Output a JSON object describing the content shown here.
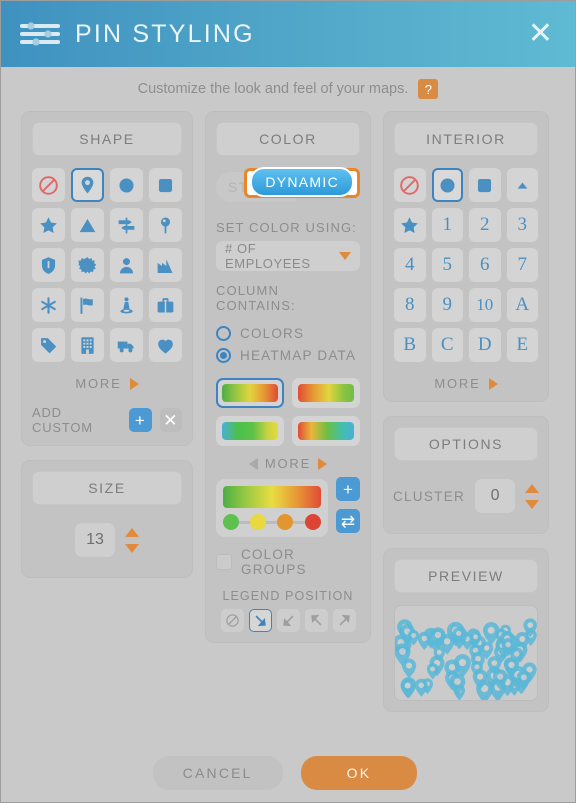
{
  "header": {
    "title": "PIN STYLING",
    "icon": "sliders-icon",
    "close_label": "✕"
  },
  "subtitle": {
    "text": "Customize the look and feel of your maps.",
    "help_label": "?"
  },
  "shape": {
    "header": "SHAPE",
    "icons": [
      {
        "name": "no-shape-icon",
        "glyph": "none",
        "selected": false
      },
      {
        "name": "map-pin-icon",
        "glyph": "pin",
        "selected": true
      },
      {
        "name": "circle-icon",
        "glyph": "circle",
        "selected": false
      },
      {
        "name": "square-icon",
        "glyph": "square",
        "selected": false
      },
      {
        "name": "star-icon",
        "glyph": "star",
        "selected": false
      },
      {
        "name": "triangle-icon",
        "glyph": "triangle",
        "selected": false
      },
      {
        "name": "signpost-icon",
        "glyph": "signpost",
        "selected": false
      },
      {
        "name": "pushpin-icon",
        "glyph": "pushpin",
        "selected": false
      },
      {
        "name": "shield-icon",
        "glyph": "shield",
        "selected": false
      },
      {
        "name": "burst-icon",
        "glyph": "burst",
        "selected": false
      },
      {
        "name": "person-icon",
        "glyph": "person",
        "selected": false
      },
      {
        "name": "factory-icon",
        "glyph": "factory",
        "selected": false
      },
      {
        "name": "asterisk-icon",
        "glyph": "asterisk",
        "selected": false
      },
      {
        "name": "flag-icon",
        "glyph": "flag",
        "selected": false
      },
      {
        "name": "statue-icon",
        "glyph": "statue",
        "selected": false
      },
      {
        "name": "briefcase-icon",
        "glyph": "briefcase",
        "selected": false
      },
      {
        "name": "tag-icon",
        "glyph": "tag",
        "selected": false
      },
      {
        "name": "building-icon",
        "glyph": "building",
        "selected": false
      },
      {
        "name": "truck-icon",
        "glyph": "truck",
        "selected": false
      },
      {
        "name": "heart-icon",
        "glyph": "heart",
        "selected": false
      }
    ],
    "more_label": "MORE",
    "add_custom_label": "ADD CUSTOM",
    "add_label": "+",
    "remove_label": "✕"
  },
  "size": {
    "header": "SIZE",
    "value": "13"
  },
  "color": {
    "header": "COLOR",
    "static_label": "STATIC",
    "dynamic_label": "DYNAMIC",
    "dynamic_selected": true,
    "highlight_color": "#e8862a",
    "set_color_using_label": "SET COLOR USING:",
    "column_value": "# OF EMPLOYEES",
    "column_contains_label": "COLUMN CONTAINS:",
    "options": [
      {
        "label": "COLORS",
        "selected": false
      },
      {
        "label": "HEATMAP DATA",
        "selected": true
      }
    ],
    "gradients": [
      {
        "name": "gradient-green-yellow-red",
        "css": "linear-gradient(90deg,#4caf45 0%,#8fc442 22%,#e2d53e 50%,#e79a36 74%,#e04b35 100%)",
        "selected": true
      },
      {
        "name": "gradient-red-yellow-green",
        "css": "linear-gradient(90deg,#e04b35 0%,#e79a36 28%,#e2d53e 55%,#8fc442 80%,#6dbf44 100%)",
        "selected": false
      },
      {
        "name": "gradient-blue-green-yellow",
        "css": "linear-gradient(90deg,#49b0d8 0%,#4cc04c 28%,#5cc148 55%,#c9d341 82%,#e6d93d 100%)",
        "selected": false
      },
      {
        "name": "gradient-red-green-blue",
        "css": "linear-gradient(90deg,#e04b35 0%,#e8b63a 24%,#6dbf44 52%,#43bfa8 78%,#49b0d8 100%)",
        "selected": false
      }
    ],
    "gradient_more_label": "MORE",
    "editor_bar_css": "linear-gradient(90deg,#4caf45 0%,#9cc943 24%,#e8dd42 50%,#e79a36 75%,#e04b35 100%)",
    "stops": [
      {
        "name": "color-stop-green",
        "color": "#5ec04e",
        "pos": 0
      },
      {
        "name": "color-stop-yellow",
        "color": "#e8d940",
        "pos": 33
      },
      {
        "name": "color-stop-orange",
        "color": "#e2962f",
        "pos": 66
      },
      {
        "name": "color-stop-red",
        "color": "#dc4434",
        "pos": 100
      }
    ],
    "add_stop_label": "+",
    "swap_label": "⇄",
    "color_groups_label": "COLOR GROUPS",
    "color_groups_checked": false,
    "legend_position_label": "LEGEND POSITION",
    "legend_positions": [
      {
        "name": "legend-none-icon",
        "glyph": "none",
        "selected": false
      },
      {
        "name": "legend-bottom-right-icon",
        "glyph": "arrow-down-right",
        "selected": true
      },
      {
        "name": "legend-bottom-left-icon",
        "glyph": "arrow-down-left",
        "selected": false
      },
      {
        "name": "legend-top-left-icon",
        "glyph": "arrow-up-left",
        "selected": false
      },
      {
        "name": "legend-top-right-icon",
        "glyph": "arrow-up-right",
        "selected": false
      }
    ]
  },
  "interior": {
    "header": "INTERIOR",
    "icons": [
      {
        "name": "no-interior-icon",
        "glyph": "none",
        "selected": false
      },
      {
        "name": "circle-interior-icon",
        "glyph": "circle",
        "selected": true
      },
      {
        "name": "square-interior-icon",
        "glyph": "square",
        "selected": false
      },
      {
        "name": "triangle-interior-icon",
        "glyph": "triangle-small",
        "selected": false
      },
      {
        "name": "star-interior-icon",
        "glyph": "star",
        "selected": false
      },
      {
        "name": "digit-1-icon",
        "glyph": "1",
        "selected": false
      },
      {
        "name": "digit-2-icon",
        "glyph": "2",
        "selected": false
      },
      {
        "name": "digit-3-icon",
        "glyph": "3",
        "selected": false
      },
      {
        "name": "digit-4-icon",
        "glyph": "4",
        "selected": false
      },
      {
        "name": "digit-5-icon",
        "glyph": "5",
        "selected": false
      },
      {
        "name": "digit-6-icon",
        "glyph": "6",
        "selected": false
      },
      {
        "name": "digit-7-icon",
        "glyph": "7",
        "selected": false
      },
      {
        "name": "digit-8-icon",
        "glyph": "8",
        "selected": false
      },
      {
        "name": "digit-9-icon",
        "glyph": "9",
        "selected": false
      },
      {
        "name": "digit-10-icon",
        "glyph": "10",
        "selected": false
      },
      {
        "name": "letter-a-icon",
        "glyph": "A",
        "selected": false
      },
      {
        "name": "letter-b-icon",
        "glyph": "B",
        "selected": false
      },
      {
        "name": "letter-c-icon",
        "glyph": "C",
        "selected": false
      },
      {
        "name": "letter-d-icon",
        "glyph": "D",
        "selected": false
      },
      {
        "name": "letter-e-icon",
        "glyph": "E",
        "selected": false
      }
    ],
    "more_label": "MORE"
  },
  "options": {
    "header": "OPTIONS",
    "cluster_label": "CLUSTER",
    "cluster_value": "0"
  },
  "preview": {
    "header": "PREVIEW",
    "pin_color": "#5bb8d8"
  },
  "footer": {
    "cancel_label": "CANCEL",
    "ok_label": "OK",
    "ok_color": "#d98b44"
  }
}
